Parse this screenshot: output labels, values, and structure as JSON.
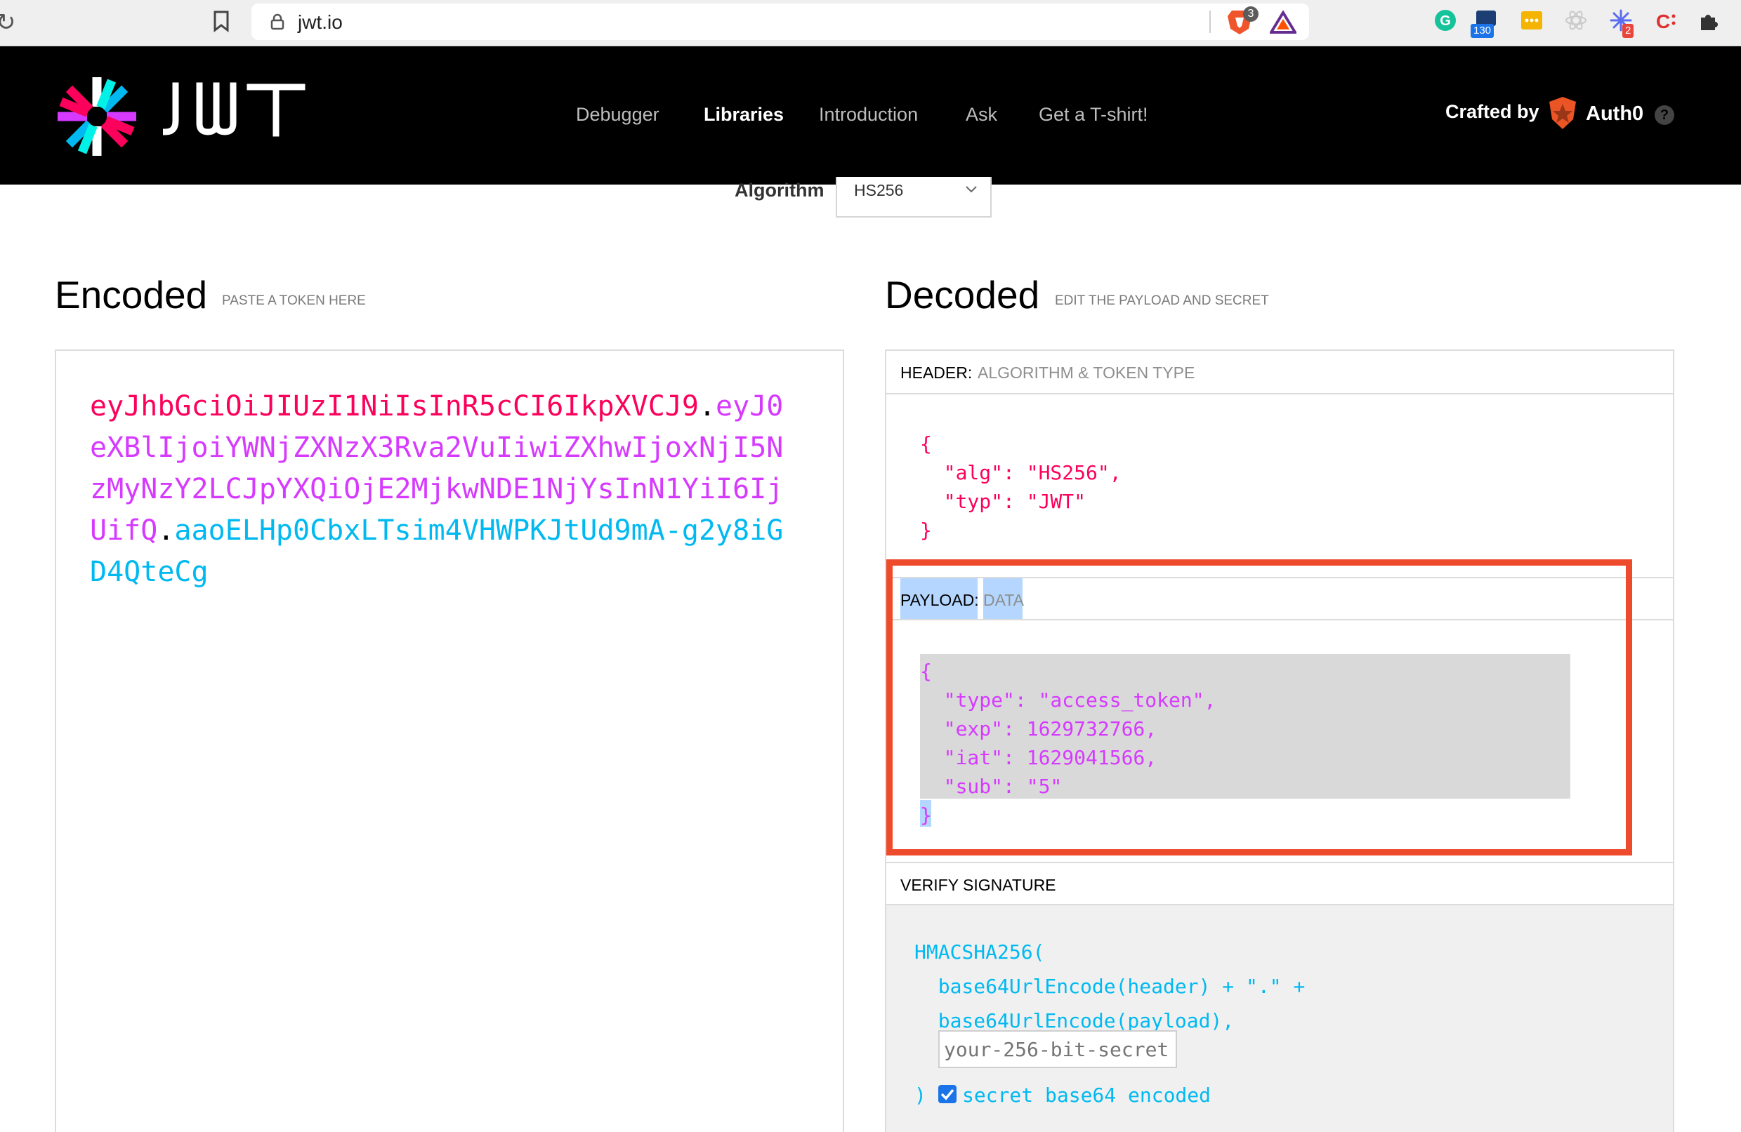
{
  "browser": {
    "url": "jwt.io",
    "brave_badge": "3",
    "ext_badge_count": "130",
    "ext_badge_small": "2"
  },
  "header": {
    "nav": [
      "Debugger",
      "Libraries",
      "Introduction",
      "Ask",
      "Get a T-shirt!"
    ],
    "active_nav": "Libraries",
    "crafted_by": "Crafted by",
    "auth0": "Auth0",
    "help": "?"
  },
  "algorithm": {
    "label": "Algorithm",
    "value": "HS256"
  },
  "encoded": {
    "title": "Encoded",
    "subtitle": "PASTE A TOKEN HERE",
    "token_header": "eyJhbGciOiJIUzI1NiIsInR5cCI6IkpXVCJ9",
    "token_payload": "eyJ0eXBlIjoiYWNjZXNzX3Rva2VuIiwiZXhwIjoxNjI5NzMyNzY2LCJpYXQiOjE2MjkwNDE1NjYsInN1YiI6IjUifQ",
    "token_signature": "aaoELHp0CbxLTsim4VHWPKJtUd9mA-g2y8iGD4QteCg",
    "dot": "."
  },
  "decoded": {
    "title": "Decoded",
    "subtitle": "EDIT THE PAYLOAD AND SECRET",
    "header_label": "HEADER:",
    "header_sub": "ALGORITHM & TOKEN TYPE",
    "header_json": {
      "open": "{",
      "line1": "  \"alg\": \"HS256\",",
      "line2": "  \"typ\": \"JWT\"",
      "close": "}"
    },
    "payload_label": "PAYLOAD:",
    "payload_sub": "DATA",
    "payload_json": {
      "open": "{",
      "line1": "  \"type\": \"access_token\",",
      "line2": "  \"exp\": 1629732766,",
      "line3": "  \"iat\": 1629041566,",
      "line4": "  \"sub\": \"5\"",
      "close": "}"
    },
    "verify_label": "VERIFY SIGNATURE",
    "verify": {
      "fn": "HMACSHA256(",
      "line1": "  base64UrlEncode(header) + \".\" +",
      "line2": "  base64UrlEncode(payload),",
      "secret_placeholder": "your-256-bit-secret",
      "close": ")",
      "checkbox_label": "secret base64 encoded",
      "checkbox_checked": true
    }
  },
  "colors": {
    "token_header": "#fb015b",
    "token_payload": "#d63aff",
    "token_signature": "#00b9f1",
    "annotation_box": "#ee4a2c",
    "selection": "#b4d6ff"
  }
}
